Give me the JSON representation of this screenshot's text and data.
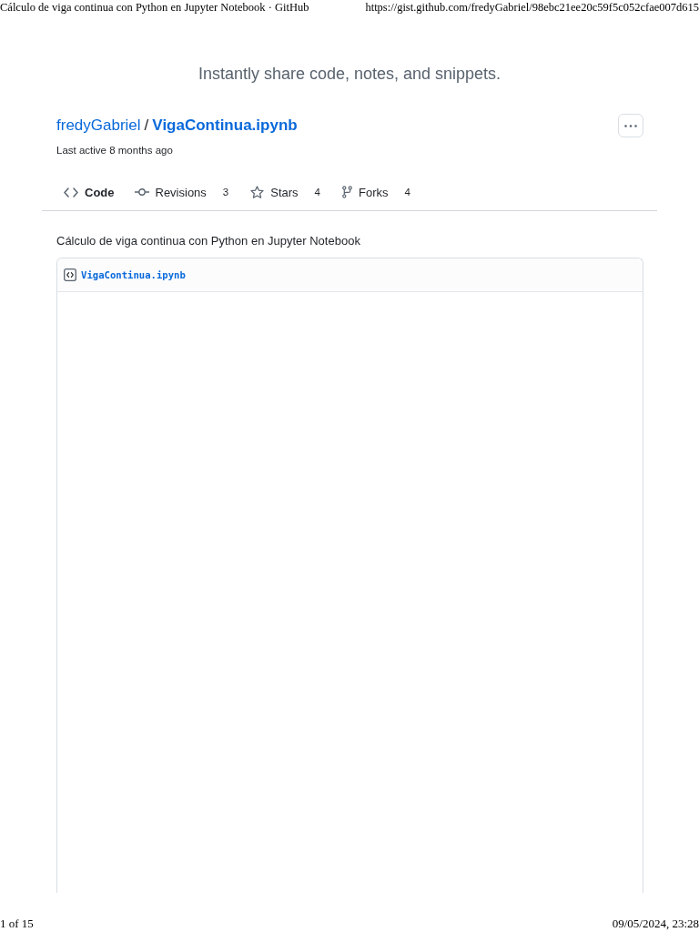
{
  "print_header": {
    "title": "Cálculo de viga continua con Python en Jupyter Notebook · GitHub",
    "url": "https://gist.github.com/fredyGabriel/98ebc21ee20c59f5c052cfae007d615"
  },
  "tagline": "Instantly share code, notes, and snippets.",
  "gist": {
    "owner": "fredyGabriel",
    "separator": "/",
    "name": "VigaContinua.ipynb",
    "last_active": "Last active 8 months ago"
  },
  "tabs": [
    {
      "kind": "code",
      "label": "Code",
      "selected": true
    },
    {
      "kind": "revisions",
      "label": "Revisions",
      "count": "3",
      "selected": false
    },
    {
      "kind": "stars",
      "label": "Stars",
      "count": "4",
      "selected": false
    },
    {
      "kind": "forks",
      "label": "Forks",
      "count": "4",
      "selected": false
    }
  ],
  "description": "Cálculo de viga continua con Python en Jupyter Notebook",
  "files": [
    {
      "name": "VigaContinua.ipynb"
    }
  ],
  "print_footer": {
    "page": "1 of 15",
    "date": "09/05/2024, 23:28"
  }
}
